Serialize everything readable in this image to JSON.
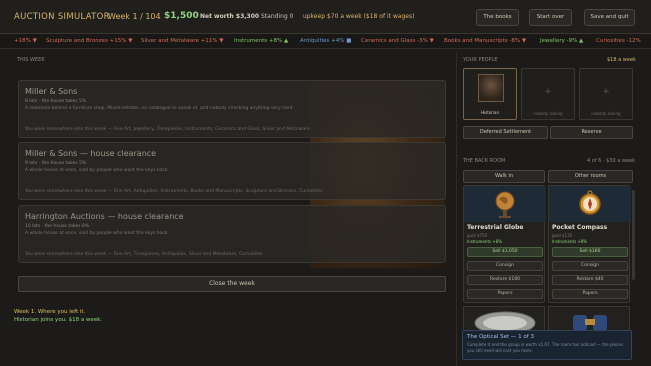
{
  "header": {
    "title": "AUCTION SIMULATOR",
    "week": "Week 1 / 104",
    "cash": "$1,500",
    "net_worth": "Net worth $3,300",
    "standing": "Standing 0",
    "upkeep": "upkeep $70 a week ($18 of it wages)",
    "buttons": {
      "books": "The books",
      "start_over": "Start over",
      "save_quit": "Save and quit"
    }
  },
  "ticker": [
    {
      "text": "+18% ▼",
      "trend": "down"
    },
    {
      "text": "Sculpture and Bronzes +15% ▼",
      "trend": "down"
    },
    {
      "text": "Silver and Metalware +11% ▼",
      "trend": "down"
    },
    {
      "text": "Instruments +8% ▲",
      "trend": "up"
    },
    {
      "text": "Antiquities +4% ■",
      "trend": "flat"
    },
    {
      "text": "Ceramics and Glass -3% ▼",
      "trend": "down"
    },
    {
      "text": "Books and Manuscripts -8% ▼",
      "trend": "down"
    },
    {
      "text": "Jewellery -9% ▲",
      "trend": "up"
    },
    {
      "text": "Curiosities -12%",
      "trend": "down"
    }
  ],
  "main": {
    "section_label": "THIS WEEK",
    "lots": [
      {
        "name": "Miller & Sons",
        "meta": "8 lots  ·  the house takes 5%",
        "desc": "A saleroom behind a furniture shop. Mixed estates, no catalogue to speak of, and nobody checking anything very hard.",
        "prev": "You were somewhere else this week — Fine Art, Jewellery, Timepieces, Instruments, Ceramics and Glass, Silver and Metalware"
      },
      {
        "name": "Miller & Sons — house clearance",
        "meta": "9 lots  ·  the house takes 5%",
        "desc": "A whole house at once, sold by people who want the keys back.",
        "prev": "You were somewhere else this week — Fine Art, Antiquities, Instruments, Books and Manuscripts, Sculpture and Bronzes, Curiosities"
      },
      {
        "name": "Harrington Auctions — house clearance",
        "meta": "10 lots  ·  the house takes 8%",
        "desc": "A whole house at once, sold by people who want the keys back.",
        "prev": "You were somewhere else this week — Fine Art, Timepieces, Antiquities, Silver and Metalware, Curiosities"
      }
    ],
    "close_week": "Close the week"
  },
  "log": [
    "Week 1. Where you left it.",
    "Historian joins you. $18 a week."
  ],
  "people": {
    "label": "YOUR PEOPLE",
    "cost": "$18 a week",
    "slots": [
      {
        "name": "Historian",
        "filled": true
      },
      {
        "name": "nobody asking",
        "filled": false
      },
      {
        "name": "nobody asking",
        "filled": false
      }
    ],
    "buttons": {
      "deferred": "Deferred Settlement",
      "reserve": "Reserve"
    }
  },
  "backroom": {
    "label": "THE BACK ROOM",
    "count": "4 of 6  ·  $30 a week",
    "tabs": [
      "Walk in",
      "Other rooms"
    ],
    "items": [
      {
        "name": "Terrestrial Globe",
        "guide": "guid $750",
        "market": "Instruments +8%",
        "sell": "Sell $1,050",
        "consign": "Consign",
        "restore": "Restore $180",
        "papers": "Papers"
      },
      {
        "name": "Pocket Compass",
        "guide": "guid $135",
        "market": "Instruments +8%",
        "sell": "Sell $160",
        "consign": "Consign",
        "restore": "Restore $40",
        "papers": "Papers"
      }
    ],
    "set": {
      "title": "The Optical Set — 1 of 3",
      "desc": "Complete it and the group is worth x1.67. The room has noticed — the pieces you still need will cost you more."
    }
  }
}
